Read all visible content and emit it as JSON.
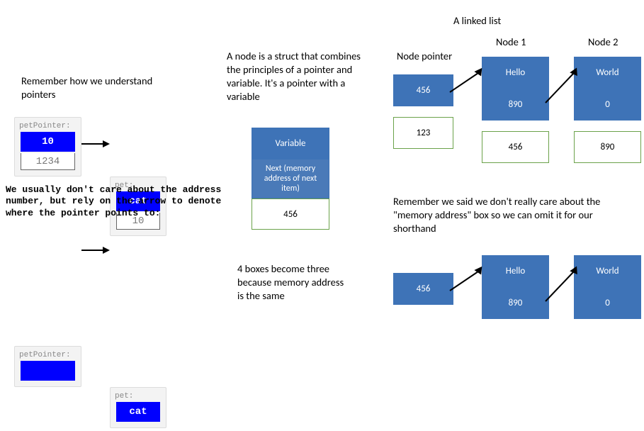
{
  "left": {
    "heading": "Remember how we understand pointers",
    "card1a": {
      "label": "petPointer:",
      "top": "10",
      "bottom": "1234"
    },
    "card1b": {
      "label": "pet:",
      "top": "cat",
      "bottom": "10"
    },
    "mono_note": "We usually don't care about the address number, but rely on the arrow to denote where the pointer points to:",
    "card2a": {
      "label": "petPointer:",
      "top": ""
    },
    "card2b": {
      "label": "pet:",
      "top": "cat"
    }
  },
  "mid": {
    "heading": "A node is a struct that combines the principles of a pointer and variable. It's a pointer with a variable",
    "box1": "Variable",
    "box2": "Next (memory address of next item)",
    "box3": "456",
    "footer": "4 boxes become three because memory address is the same"
  },
  "right": {
    "title": "A linked list",
    "col0": "Node pointer",
    "col1": "Node 1",
    "col2": "Node 2",
    "np_top": "456",
    "np_bottom": "123",
    "n1_top": "Hello",
    "n1_mid": "890",
    "n1_bot": "456",
    "n2_top": "World",
    "n2_mid": "0",
    "n2_bot": "890",
    "note": "Remember we said we don't really care about the \"memory address\" box so we can omit it for our shorthand",
    "s_np": "456",
    "s_n1a": "Hello",
    "s_n1b": "890",
    "s_n2a": "World",
    "s_n2b": "0"
  }
}
